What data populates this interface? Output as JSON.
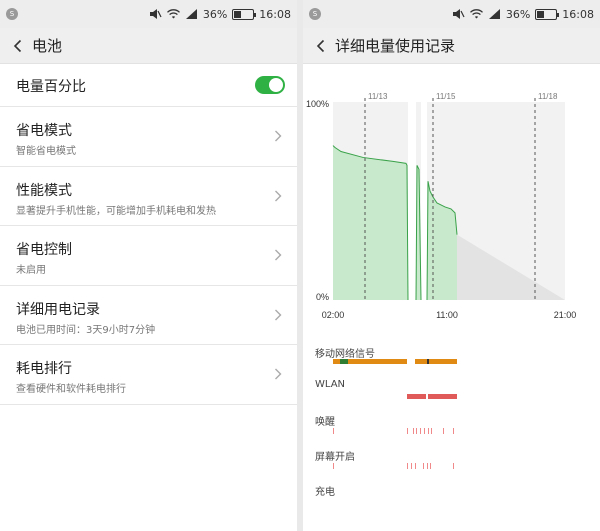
{
  "status": {
    "app_badge": "S",
    "battery_text": "36%",
    "battery_level": 0.36,
    "time": "16:08"
  },
  "left": {
    "header": {
      "title": "电池"
    },
    "percent_toggle": {
      "label": "电量百分比",
      "on": true
    },
    "items": [
      {
        "title": "省电模式",
        "subtitle": "智能省电模式"
      },
      {
        "title": "性能模式",
        "subtitle": "显著提升手机性能，可能增加手机耗电和发热"
      },
      {
        "title": "省电控制",
        "subtitle": "未启用"
      },
      {
        "title": "详细用电记录",
        "subtitle": "电池已用时间：3天9小时7分钟"
      },
      {
        "title": "耗电排行",
        "subtitle": "查看硬件和软件耗电排行"
      }
    ]
  },
  "right": {
    "header": {
      "title": "详细电量使用记录"
    },
    "chart_data": {
      "type": "area",
      "y_labels": [
        "100%",
        "0%"
      ],
      "ylim": [
        0,
        100
      ],
      "x_ticks": [
        "02:00",
        "11:00",
        "21:00"
      ],
      "date_markers": [
        "11/13",
        "11/15",
        "11/18"
      ],
      "fill_color": "#c8e9cb",
      "line_color": "#3aa24a",
      "projection_color": "#e3e3e3",
      "plot_bg": "#f2f2f2",
      "segments": [
        {
          "x": [
            0,
            2,
            8,
            30,
            60,
            73,
            74,
            75
          ],
          "y": [
            78,
            77,
            75,
            72,
            70,
            69,
            68,
            0
          ]
        },
        {
          "x": [
            83,
            84,
            86,
            88
          ],
          "y": [
            0,
            68,
            66,
            0
          ]
        },
        {
          "x": [
            94,
            95,
            97,
            100,
            104,
            108,
            112,
            118,
            122,
            124
          ],
          "y": [
            0,
            60,
            55,
            52,
            49,
            48,
            47,
            46,
            44,
            33
          ]
        }
      ],
      "gaps": [
        {
          "x": [
            75,
            83
          ]
        },
        {
          "x": [
            88,
            94
          ]
        }
      ],
      "projection": {
        "x": [
          124,
          232
        ],
        "y": [
          33,
          0
        ]
      }
    },
    "tracks": [
      {
        "label": "移动网络信号",
        "color": "#e08a14",
        "accent": "#2e7d32"
      },
      {
        "label": "WLAN",
        "color": "#e05a5a"
      },
      {
        "label": "唤醒",
        "color": "#f08a8a"
      },
      {
        "label": "屏幕开启",
        "color": "#f08a8a"
      },
      {
        "label": "充电",
        "color": "#4caf50"
      }
    ]
  }
}
